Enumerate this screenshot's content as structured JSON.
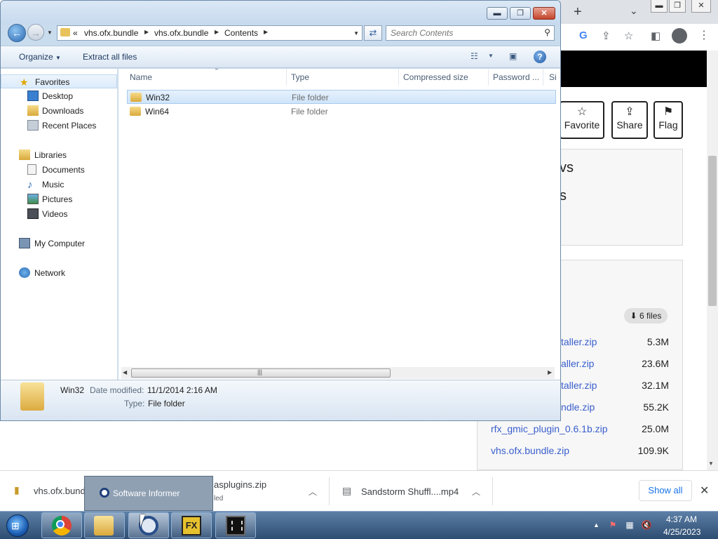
{
  "explorer": {
    "window_controls": {
      "minimize": "▬",
      "maximize": "❐",
      "close": "✕"
    },
    "address": {
      "overflow": "«",
      "crumbs": [
        "vhs.ofx.bundle",
        "vhs.ofx.bundle",
        "Contents"
      ]
    },
    "search_placeholder": "Search Contents",
    "toolbar": {
      "organize": "Organize",
      "extract_all": "Extract all files"
    },
    "nav": {
      "favorites": "Favorites",
      "desktop": "Desktop",
      "downloads": "Downloads",
      "recent_places": "Recent Places",
      "libraries": "Libraries",
      "documents": "Documents",
      "music": "Music",
      "pictures": "Pictures",
      "videos": "Videos",
      "my_computer": "My Computer",
      "network": "Network"
    },
    "columns": {
      "name": "Name",
      "type": "Type",
      "compressed_size": "Compressed size",
      "password": "Password ...",
      "size": "Si"
    },
    "rows": [
      {
        "name": "Win32",
        "type": "File folder"
      },
      {
        "name": "Win64",
        "type": "File folder"
      }
    ],
    "details": {
      "name": "Win32",
      "modified_label": "Date modified:",
      "modified_value": "11/1/2014 2:16 AM",
      "type_label": "Type:",
      "type_value": "File folder"
    }
  },
  "browser": {
    "tab_controls": {
      "new_tab": "+",
      "tab_menu": "⌄",
      "minimize": "▬",
      "maximize": "❐",
      "close": "✕"
    },
    "actions": [
      {
        "icon": "☆",
        "label": "Favorite"
      },
      {
        "icon": "⇪",
        "label": "Share"
      },
      {
        "icon": "⚑",
        "label": "Flag"
      }
    ],
    "info_partial": [
      "vs",
      "s"
    ],
    "files_badge": "6 files",
    "files": [
      {
        "name": "taller.zip",
        "size": "5.3M"
      },
      {
        "name": "aller.zip",
        "size": "23.6M"
      },
      {
        "name": "taller.zip",
        "size": "32.1M"
      },
      {
        "name": "ndle.zip",
        "size": "55.2K"
      },
      {
        "name": "rfx_gmic_plugin_0.6.1b.zip",
        "size": "25.0M"
      },
      {
        "name": "vhs.ofx.bundle.zip",
        "size": "109.9K"
      }
    ]
  },
  "downloads_bar": {
    "items": [
      {
        "name": "vhs.ofx.bund",
        "sub": ""
      },
      {
        "name": "asplugins.zip",
        "sub": "led"
      },
      {
        "name": "Sandstorm Shuffl....mp4",
        "sub": ""
      }
    ],
    "show_all": "Show all",
    "close": "✕"
  },
  "tooltip": {
    "text": "Software Informer"
  },
  "taskbar": {
    "fx_label": "FX",
    "clock_time": "4:37 AM",
    "clock_date": "4/25/2023"
  }
}
